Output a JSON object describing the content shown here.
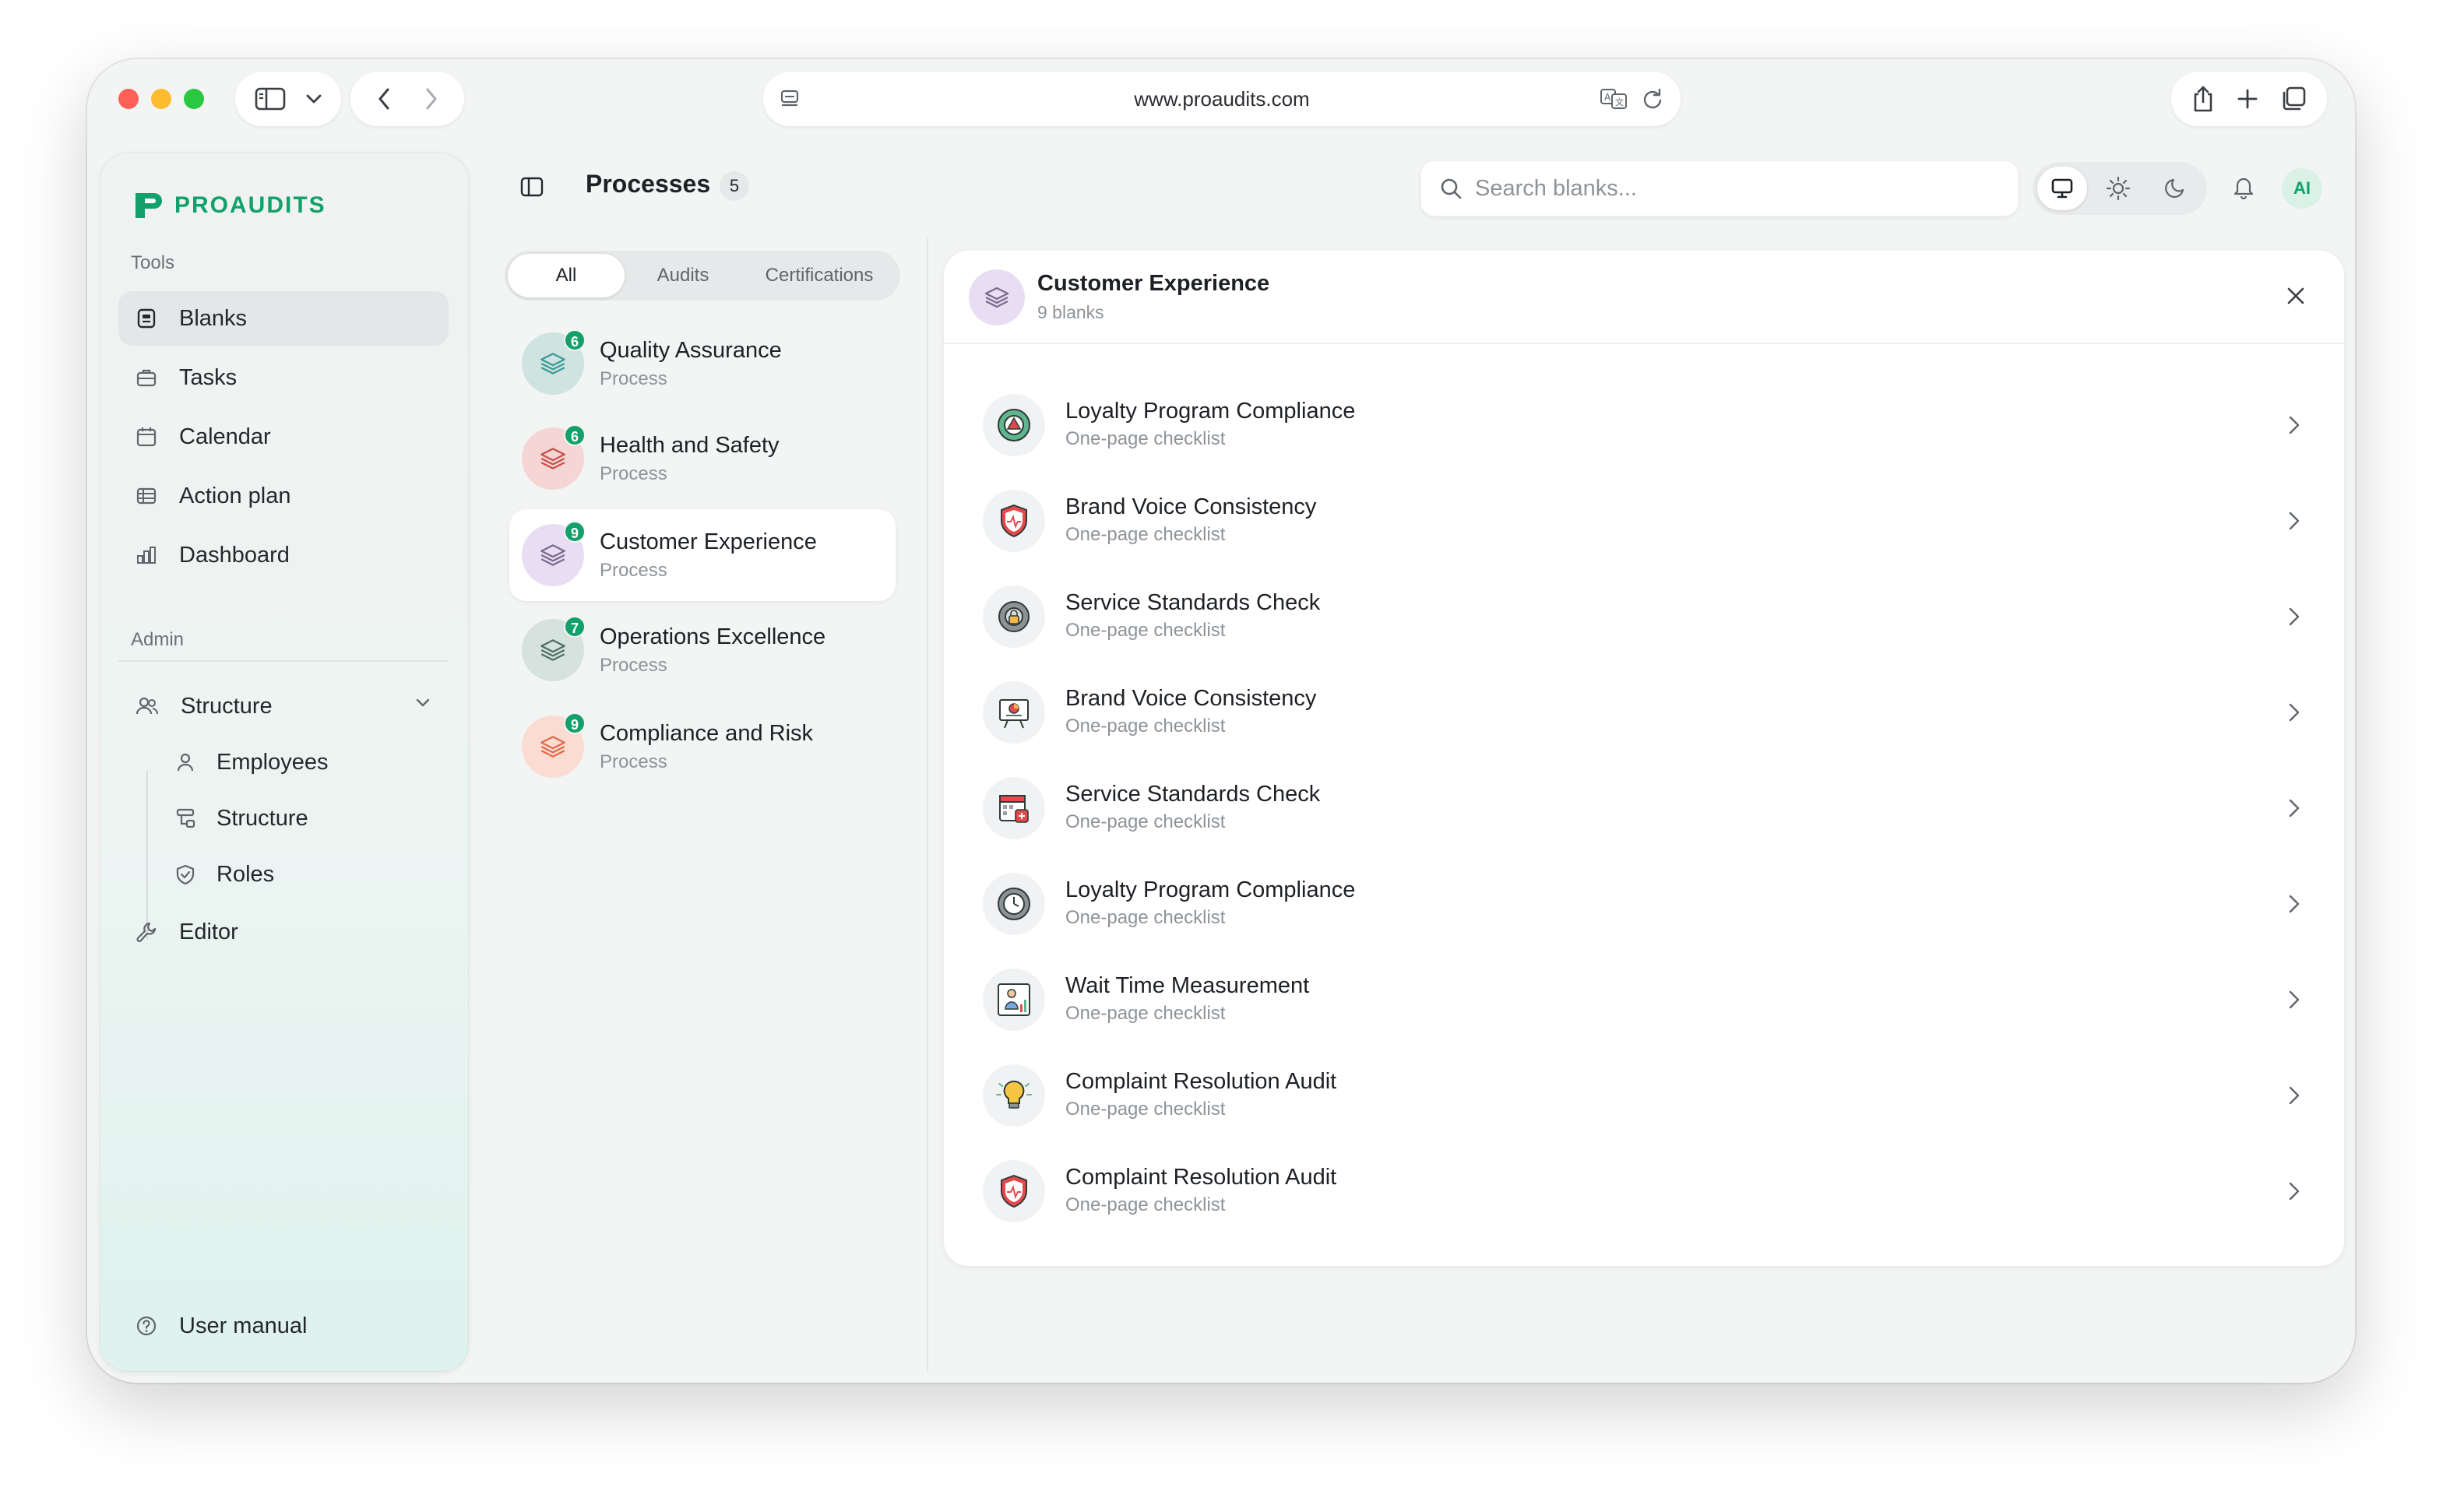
{
  "browser": {
    "url": "www.proaudits.com"
  },
  "sidebar": {
    "logo_text": "PROAUDITS",
    "tools_label": "Tools",
    "tools": [
      {
        "label": "Blanks",
        "icon": "blanks-icon",
        "active": true
      },
      {
        "label": "Tasks",
        "icon": "briefcase-icon"
      },
      {
        "label": "Calendar",
        "icon": "calendar-icon"
      },
      {
        "label": "Action plan",
        "icon": "table-icon"
      },
      {
        "label": "Dashboard",
        "icon": "bar-chart-icon"
      }
    ],
    "admin_label": "Admin",
    "structure_label": "Structure",
    "structure_children": [
      {
        "label": "Employees",
        "icon": "user-icon"
      },
      {
        "label": "Structure",
        "icon": "hierarchy-icon"
      },
      {
        "label": "Roles",
        "icon": "shield-check-icon"
      }
    ],
    "editor_label": "Editor",
    "user_manual_label": "User manual"
  },
  "header": {
    "title": "Processes",
    "count": "5",
    "search_placeholder": "Search blanks...",
    "avatar_initials": "AI"
  },
  "filters": {
    "tabs": [
      "All",
      "Audits",
      "Certifications"
    ],
    "selected": "All"
  },
  "processes": [
    {
      "title": "Quality Assurance",
      "subtitle": "Process",
      "badge": "6",
      "color": "#cfe3e1",
      "stroke": "#3a9a93"
    },
    {
      "title": "Health and Safety",
      "subtitle": "Process",
      "badge": "6",
      "color": "#f5d6d4",
      "stroke": "#c9504a"
    },
    {
      "title": "Customer Experience",
      "subtitle": "Process",
      "badge": "9",
      "color": "#e8ddf3",
      "stroke": "#7a6a8c",
      "active": true
    },
    {
      "title": "Operations Excellence",
      "subtitle": "Process",
      "badge": "7",
      "color": "#d5e2dd",
      "stroke": "#4f6e66"
    },
    {
      "title": "Compliance and Risk",
      "subtitle": "Process",
      "badge": "9",
      "color": "#fbdcd2",
      "stroke": "#e06b4a"
    }
  ],
  "detail": {
    "title": "Customer Experience",
    "subtitle": "9 blanks",
    "items": [
      {
        "title": "Loyalty Program Compliance",
        "subtitle": "One-page checklist",
        "icon": "gear-warning-icon"
      },
      {
        "title": "Brand Voice Consistency",
        "subtitle": "One-page checklist",
        "icon": "shield-heart-icon"
      },
      {
        "title": "Service Standards Check",
        "subtitle": "One-page checklist",
        "icon": "gear-lock-icon"
      },
      {
        "title": "Brand Voice Consistency",
        "subtitle": "One-page checklist",
        "icon": "presentation-board-icon"
      },
      {
        "title": "Service Standards Check",
        "subtitle": "One-page checklist",
        "icon": "calendar-plus-icon"
      },
      {
        "title": "Loyalty Program Compliance",
        "subtitle": "One-page checklist",
        "icon": "gear-clock-icon"
      },
      {
        "title": "Wait Time Measurement",
        "subtitle": "One-page checklist",
        "icon": "worker-chart-icon"
      },
      {
        "title": "Complaint Resolution Audit",
        "subtitle": "One-page checklist",
        "icon": "lightbulb-icon"
      },
      {
        "title": "Complaint Resolution Audit",
        "subtitle": "One-page checklist",
        "icon": "shield-heart-icon"
      }
    ]
  },
  "colors": {
    "brand_green": "#12a06b",
    "badge_green": "#12a06b"
  }
}
